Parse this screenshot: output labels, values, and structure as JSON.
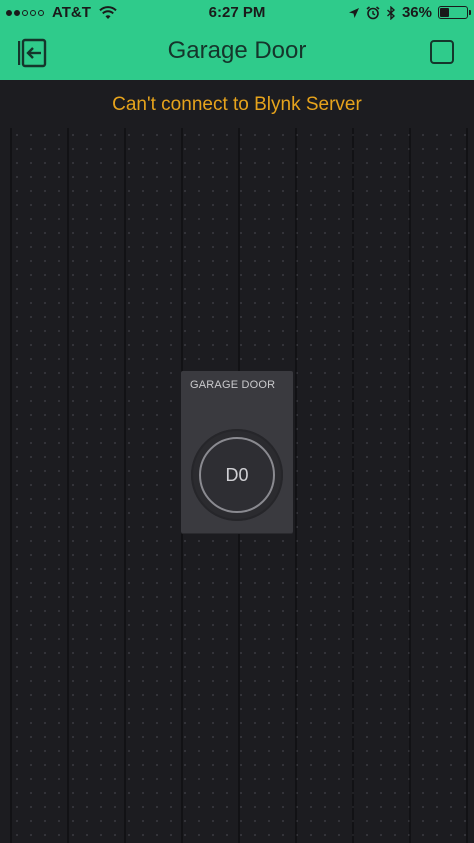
{
  "status_bar": {
    "carrier": "AT&T",
    "time": "6:27 PM",
    "battery": "36%",
    "battery_level": 0.36,
    "signal_bars_filled": 2,
    "signal_bars_total": 5
  },
  "nav": {
    "title": "Garage Door",
    "back_icon": "exit-icon",
    "menu_icon": "square-icon"
  },
  "canvas": {
    "connection_message": "Can't connect to Blynk Server"
  },
  "widget": {
    "label": "GARAGE DOOR",
    "button_text": "D0"
  },
  "colors": {
    "accent": "#2fcb8b",
    "warning": "#e6a31c",
    "background": "#1c1c20",
    "widget": "#3a3a3f"
  }
}
